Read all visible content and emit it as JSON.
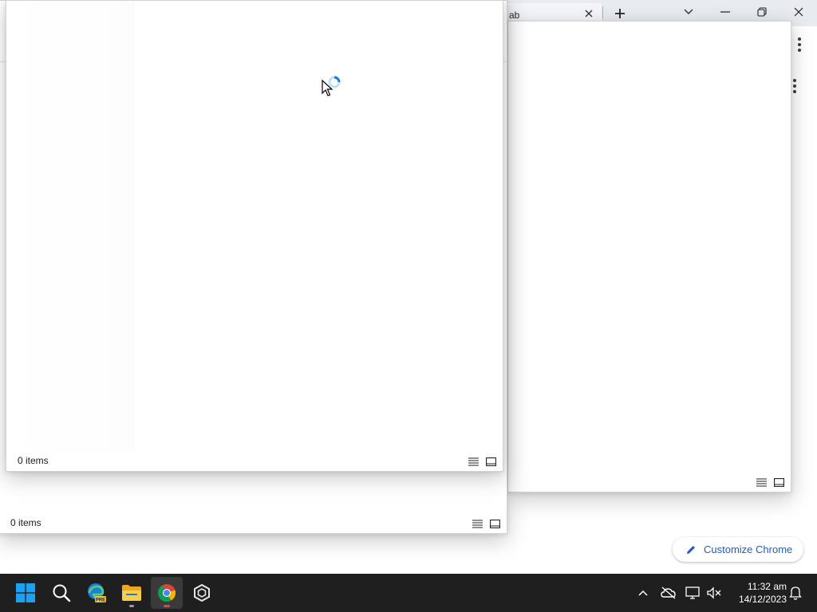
{
  "chrome": {
    "tab_title": "ab",
    "customize_label": "Customize Chrome"
  },
  "explorer_front": {
    "status_count": "0 items"
  },
  "explorer_back": {
    "status_count": "0 items"
  },
  "explorer_right": {
    "status_count": ""
  },
  "taskbar": {
    "apps": [
      "start-icon",
      "search-icon",
      "edge-beta-icon",
      "file-explorer-icon",
      "chrome-icon",
      "unity-hub-icon"
    ],
    "clock": {
      "time": "11:32 am",
      "date": "14/12/2023"
    }
  },
  "colors": {
    "taskbar_bg": "#1f1f1f",
    "accent": "#1a5fc4",
    "windows_blue": "#1ea0f0"
  }
}
